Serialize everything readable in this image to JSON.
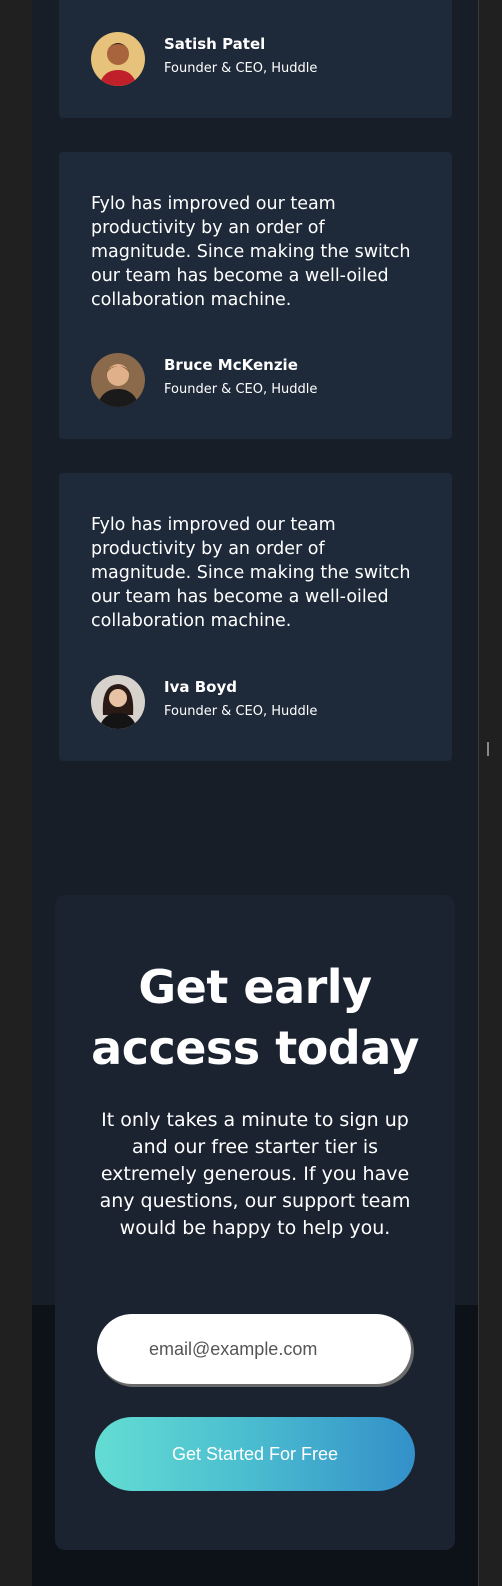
{
  "testimonials": [
    {
      "quote": "",
      "name": "Satish Patel",
      "role": "Founder & CEO, Huddle"
    },
    {
      "quote": "Fylo has improved our team productivity by an order of magnitude. Since making the switch our team has become a well-oiled collaboration machine.",
      "name": "Bruce McKenzie",
      "role": "Founder & CEO, Huddle"
    },
    {
      "quote": "Fylo has improved our team productivity by an order of magnitude. Since making the switch our team has become a well-oiled collaboration machine.",
      "name": "Iva Boyd",
      "role": "Founder & CEO, Huddle"
    }
  ],
  "cta": {
    "title": "Get early access today",
    "text": "It only takes a minute to sign up and our free starter tier is extremely generous. If you have any questions, our support team would be happy to help you.",
    "email_placeholder": "email@example.com",
    "button_label": "Get Started For Free"
  },
  "colors": {
    "page_bg": "#181e28",
    "card_bg": "#1e2939",
    "gradient_start": "#63ddd3",
    "gradient_end": "#3390c9"
  }
}
